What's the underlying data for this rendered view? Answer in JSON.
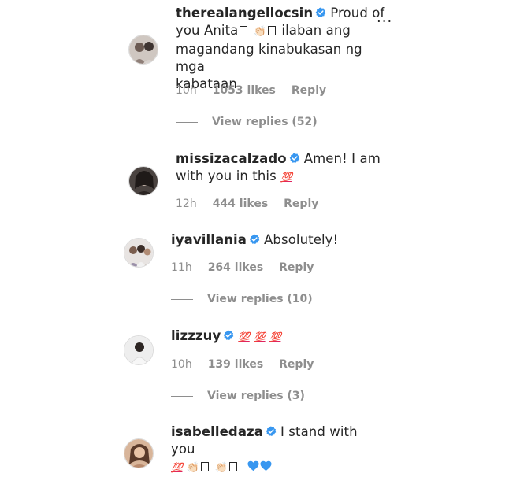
{
  "comments": [
    {
      "username": "therealangellocsin",
      "text_parts": [
        "Proud of",
        "you Anita",
        "ilaban ang",
        "magandang kinabukasan ng mga",
        "kabataan"
      ],
      "time": "10h",
      "likes": "1053 likes",
      "reply": "Reply",
      "view_replies": "View replies (52)"
    },
    {
      "username": "missizacalzado",
      "text_parts": [
        "Amen! I am",
        "with you in this"
      ],
      "time": "12h",
      "likes": "444 likes",
      "reply": "Reply"
    },
    {
      "username": "iyavillania",
      "text_parts": [
        "Absolutely!"
      ],
      "time": "11h",
      "likes": "264 likes",
      "reply": "Reply",
      "view_replies": "View replies (10)"
    },
    {
      "username": "lizzzuy",
      "text_parts": [],
      "time": "10h",
      "likes": "139 likes",
      "reply": "Reply",
      "view_replies": "View replies (3)"
    },
    {
      "username": "isabelledaza",
      "text_parts": [
        "I stand with you"
      ]
    }
  ],
  "more_options": "...",
  "hundred_emoji": "💯",
  "colors": {
    "verified_blue": "#3897f0",
    "meta_gray": "#8e8e8e",
    "heart_blue": "#3897f0",
    "hundred_red": "#e0245e"
  },
  "icons": {
    "verified": "verified-badge-icon",
    "more": "more-options-icon",
    "heart": "blue-heart-emoji",
    "hundred": "hundred-points-emoji",
    "clap": "clapping-hands-emoji"
  }
}
